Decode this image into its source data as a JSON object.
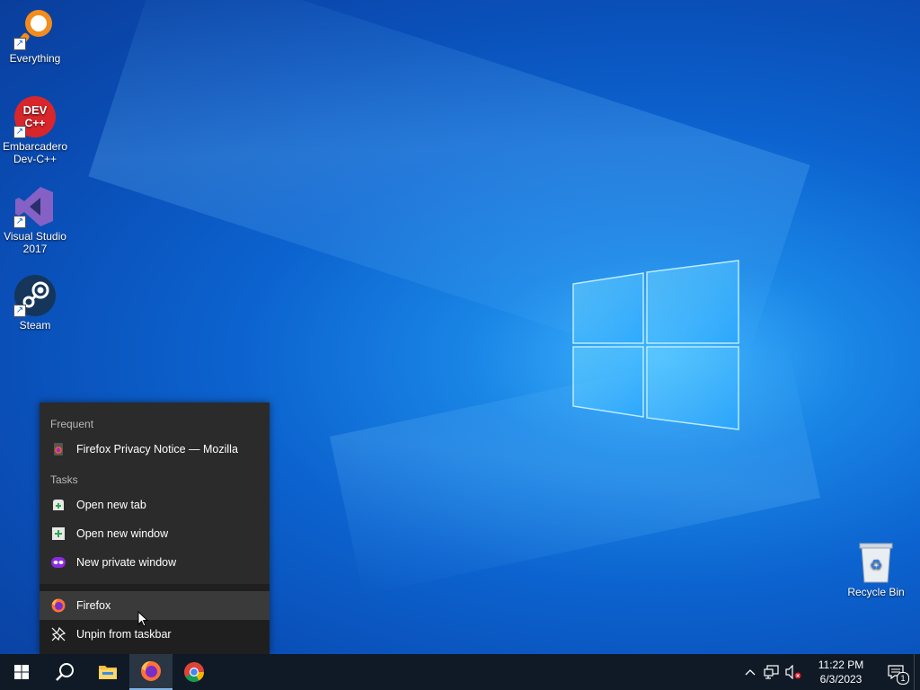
{
  "desktop_icons": [
    {
      "label": "Everything"
    },
    {
      "label": "Embarcadero\nDev-C++",
      "line1": "Embarcadero",
      "line2": "Dev-C++",
      "icon_text_1": "DEV",
      "icon_text_2": "C++"
    },
    {
      "label": "Visual Studio 2017",
      "line1": "Visual Studio",
      "line2": "2017"
    },
    {
      "label": "Steam"
    },
    {
      "label": "Recycle Bin"
    }
  ],
  "jumplist": {
    "frequent_header": "Frequent",
    "frequent_items": [
      {
        "label": "Firefox Privacy Notice — Mozilla",
        "icon": "firefox-page-icon"
      }
    ],
    "tasks_header": "Tasks",
    "task_items": [
      {
        "label": "Open new tab",
        "icon": "new-tab-icon"
      },
      {
        "label": "Open new window",
        "icon": "new-window-icon"
      },
      {
        "label": "New private window",
        "icon": "private-window-icon"
      }
    ],
    "app_item": {
      "label": "Firefox",
      "icon": "firefox-icon"
    },
    "unpin_item": {
      "label": "Unpin from taskbar",
      "icon": "unpin-icon"
    }
  },
  "taskbar": {
    "apps": [
      "start-icon",
      "search-icon",
      "file-explorer-icon",
      "firefox-icon",
      "chrome-icon"
    ],
    "clock": {
      "time": "11:22 PM",
      "date": "6/3/2023"
    },
    "notification_count": "1"
  },
  "colors": {
    "taskbar": "#101a26",
    "jumplist": "#2b2b2b",
    "accent": "#0a63cf"
  }
}
